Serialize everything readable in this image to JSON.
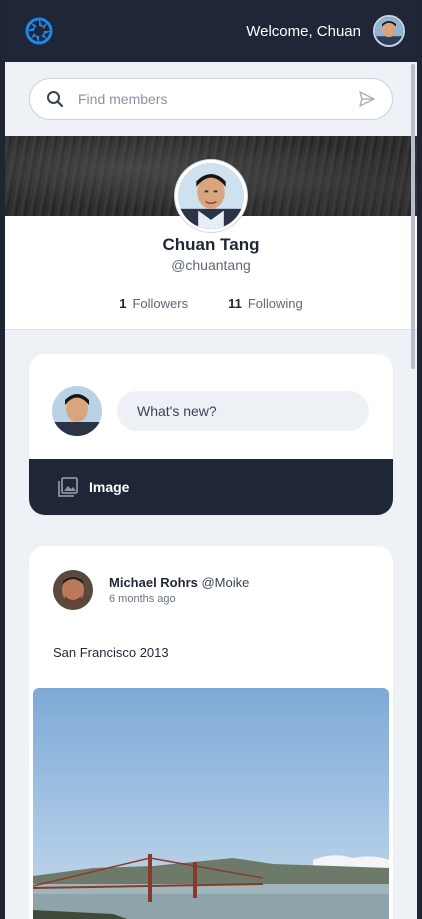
{
  "topbar": {
    "welcome_text": "Welcome, Chuan",
    "logo_icon": "aperture-logo-icon",
    "accent": "#1e88e5"
  },
  "search": {
    "placeholder": "Find members"
  },
  "profile": {
    "name": "Chuan Tang",
    "handle": "@chuantang",
    "followers_count": "1",
    "followers_label": "Followers",
    "following_count": "11",
    "following_label": "Following"
  },
  "composer": {
    "prompt": "What's new?",
    "image_label": "Image"
  },
  "post": {
    "author_name": "Michael Rohrs",
    "author_handle": "@Moike",
    "time": "6 months ago",
    "text": "San Francisco 2013"
  },
  "colors": {
    "navbar": "#1e2638",
    "page_background": "#eef1f6",
    "card": "#ffffff"
  }
}
